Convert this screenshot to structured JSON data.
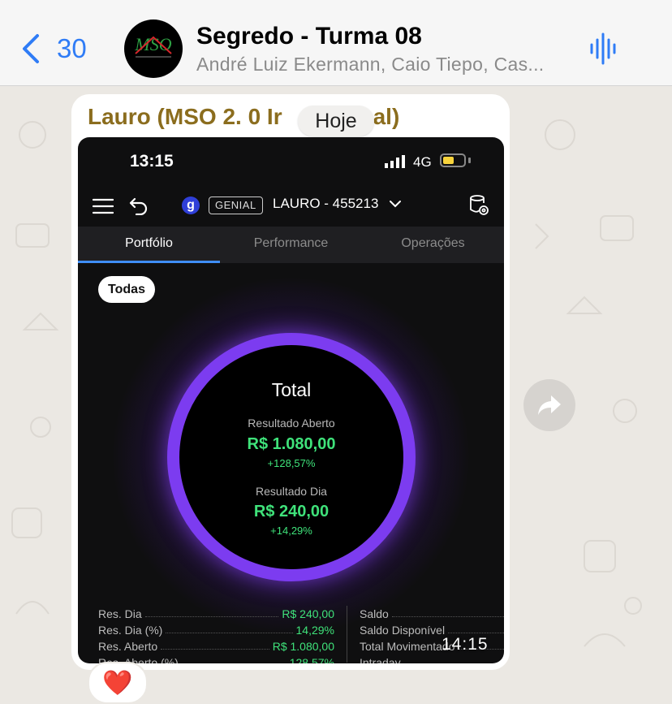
{
  "header": {
    "back_count": "30",
    "title": "Segredo - Turma 08",
    "subtitle": "André Luiz Ekermann, Caio Tiepo, Cas...",
    "avatar_logo_text": "MSO"
  },
  "message": {
    "sender": "Lauro (MSO 2. 0 Ir    al)",
    "date_chip": "Hoje",
    "timestamp": "14:15",
    "reaction": "❤️"
  },
  "screenshot": {
    "status_time": "13:15",
    "network": "4G",
    "battery_level": 0.55,
    "broker": "GENIAL",
    "account": "LAURO - 455213",
    "g_logo": "g",
    "tabs": [
      "Portfólio",
      "Performance",
      "Operações"
    ],
    "active_tab": "Portfólio",
    "filter": "Todas",
    "total_label": "Total",
    "open_result_label": "Resultado Aberto",
    "open_result_value": "R$ 1.080,00",
    "open_result_pct": "+128,57%",
    "day_result_label": "Resultado Dia",
    "day_result_value": "R$ 240,00",
    "day_result_pct": "+14,29%",
    "summary_left": [
      {
        "label": "Res. Dia",
        "value": "R$ 240,00"
      },
      {
        "label": "Res. Dia (%)",
        "value": "14,29%"
      },
      {
        "label": "Res. Aberto",
        "value": "R$ 1.080,00"
      },
      {
        "label": "Res. Aberto (%)",
        "value": "128,57%"
      }
    ],
    "summary_right": [
      {
        "label": "Saldo"
      },
      {
        "label": "Saldo Disponível"
      },
      {
        "label": "Total Movimentado"
      },
      {
        "label": "Intraday"
      }
    ]
  },
  "colors": {
    "accent_blue": "#2f7cf6",
    "sender_color": "#8b6d1e",
    "ring_purple": "#7c3cf0",
    "positive_green": "#3fe27a"
  },
  "icons": [
    "back-chevron-icon",
    "audio-waveform-icon",
    "menu-icon",
    "undo-icon",
    "settings-icon",
    "forward-icon",
    "heart-icon"
  ]
}
